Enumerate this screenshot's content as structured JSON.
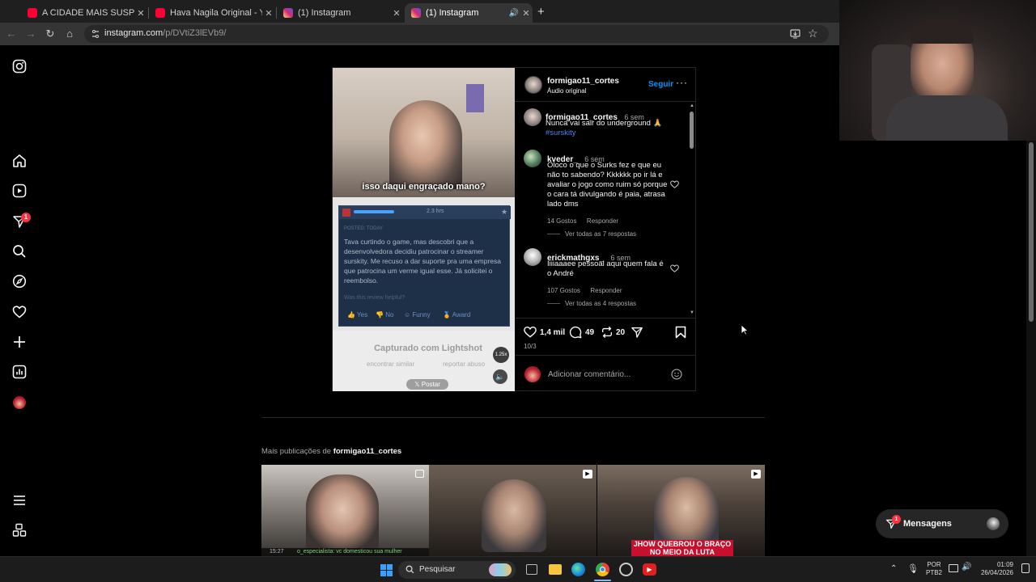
{
  "browser": {
    "tabs": [
      {
        "title": "A CIDADE MAIS SUSPEITA DO N",
        "favicon_color": "#ff0033",
        "active": false
      },
      {
        "title": "Hava Nagila Original - YouTube",
        "favicon_color": "#ff0033",
        "active": false
      },
      {
        "title": "(1) Instagram",
        "favicon_color": "#d62976",
        "active": false
      },
      {
        "title": "(1) Instagram",
        "favicon_color": "#d62976",
        "active": true
      }
    ],
    "url_host": "instagram.com",
    "url_path": "/p/DVtiZ3lEVb9/"
  },
  "sidebar": {
    "icons": [
      "instagram-logo-icon",
      "home-icon",
      "reels-icon",
      "direct-icon",
      "search-icon",
      "explore-icon",
      "heart-icon",
      "create-icon",
      "dashboard-icon",
      "profile-icon",
      "menu-icon",
      "more-apps-icon"
    ],
    "notification_count": "1"
  },
  "post": {
    "author": "formigao11_cortes",
    "audio": "Áudio original",
    "follow_label": "Seguir",
    "media": {
      "video_caption": "isso daqui engraçado mano?",
      "review_time": "2.3 hrs",
      "review_posted": "POSTED: TODAY",
      "review_text": "Tava curtindo o game, mas descobri que a desenvolvedora decidiu patrocinar o streamer surskity. Me recuso a dar suporte pra uma empresa que patrocina um verme igual esse. Já solicitei o reembolso.",
      "review_helpful": "Was this review helpful?",
      "review_yes": "Yes",
      "review_no": "No",
      "review_funny": "Funny",
      "review_award": "Award",
      "lightshot_label": "Capturado com Lightshot",
      "find_similar": "encontrar similar",
      "report_abuse": "reportar abuso",
      "post_button": "Postar",
      "speed_badge": "1.25x"
    },
    "caption": {
      "user": "formigao11_cortes",
      "time": "6 sem",
      "text": "Nunca vai sair do underground 🙏",
      "hashtag": "#surskity"
    },
    "comments": [
      {
        "user": "kveder_",
        "time": "6 sem",
        "text": "Oloco o que o Surks fez e que eu não to sabendo? Kkkkkk po ir lá e avaliar o jogo como ruim só porque o cara tá divulgando é paia, atrasa lado dms",
        "likes": "14 Gostos",
        "reply": "Responder",
        "view_replies": "Ver todas as 7 respostas"
      },
      {
        "user": "erickmathgxs_",
        "time": "6 sem",
        "text": "Iiiiaaaee pessoal aqui quem fala é o André",
        "likes": "107 Gostos",
        "reply": "Responder",
        "view_replies": "Ver todas as 4 respostas"
      }
    ],
    "actions": {
      "likes": "1,4 mil",
      "comments": "49",
      "reposts": "20"
    },
    "date": "10/3",
    "add_comment_placeholder": "Adicionar comentário..."
  },
  "more_posts": {
    "heading_prefix": "Mais publicações de",
    "heading_user": "formigao11_cortes",
    "thumbs": [
      {
        "overlay_text": "o_especialista: vc domesticou sua mulher",
        "overlay_time": "15:27"
      },
      {
        "overlay_text": ""
      },
      {
        "overlay_text": "JHOW QUEBROU O BRAÇO NO MEIO DA LUTA"
      }
    ]
  },
  "messages": {
    "label": "Mensagens",
    "badge": "1"
  },
  "taskbar": {
    "search_placeholder": "Pesquisar",
    "lang_top": "POR",
    "lang_bottom": "PTB2",
    "time": "01:09",
    "date": "26/04/2026"
  },
  "colors": {
    "accent_blue": "#0095f6",
    "hashtag_blue": "#4a86e8",
    "badge_red": "#ff3040"
  }
}
